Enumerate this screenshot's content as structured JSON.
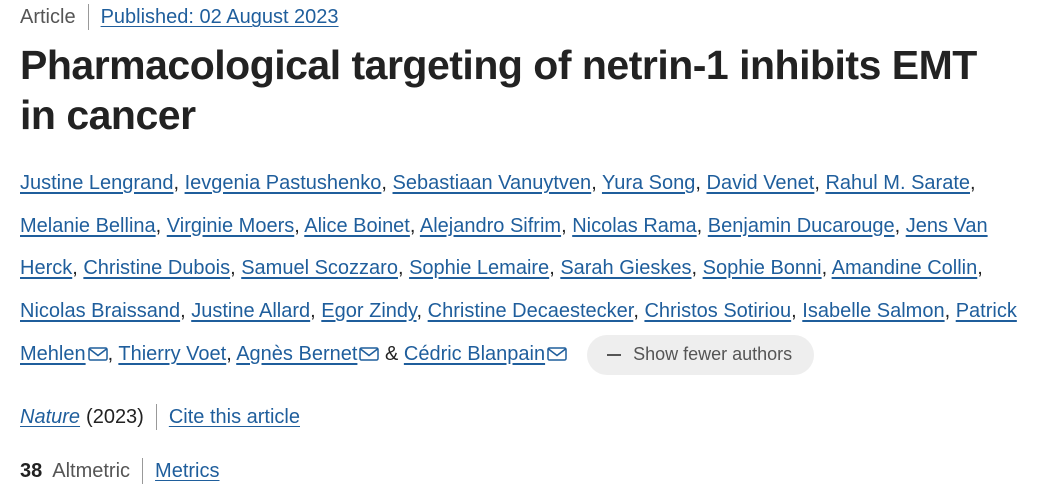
{
  "article": {
    "type_label": "Article",
    "published_label": "Published: 02 August 2023",
    "title": "Pharmacological targeting of netrin-1 inhibits EMT in cancer"
  },
  "authors": [
    {
      "name": "Justine Lengrand",
      "email": false
    },
    {
      "name": "Ievgenia Pastushenko",
      "email": false
    },
    {
      "name": "Sebastiaan Vanuytven",
      "email": false
    },
    {
      "name": "Yura Song",
      "email": false
    },
    {
      "name": "David Venet",
      "email": false
    },
    {
      "name": "Rahul M. Sarate",
      "email": false
    },
    {
      "name": "Melanie Bellina",
      "email": false
    },
    {
      "name": "Virginie Moers",
      "email": false
    },
    {
      "name": "Alice Boinet",
      "email": false
    },
    {
      "name": "Alejandro Sifrim",
      "email": false
    },
    {
      "name": "Nicolas Rama",
      "email": false
    },
    {
      "name": "Benjamin Ducarouge",
      "email": false
    },
    {
      "name": "Jens Van Herck",
      "email": false
    },
    {
      "name": "Christine Dubois",
      "email": false
    },
    {
      "name": "Samuel Scozzaro",
      "email": false
    },
    {
      "name": "Sophie Lemaire",
      "email": false
    },
    {
      "name": "Sarah Gieskes",
      "email": false
    },
    {
      "name": "Sophie Bonni",
      "email": false
    },
    {
      "name": "Amandine Collin",
      "email": false
    },
    {
      "name": "Nicolas Braissand",
      "email": false
    },
    {
      "name": "Justine Allard",
      "email": false
    },
    {
      "name": "Egor Zindy",
      "email": false
    },
    {
      "name": "Christine Decaestecker",
      "email": false
    },
    {
      "name": "Christos Sotiriou",
      "email": false
    },
    {
      "name": "Isabelle Salmon",
      "email": false
    },
    {
      "name": "Patrick Mehlen",
      "email": true
    },
    {
      "name": "Thierry Voet",
      "email": false
    },
    {
      "name": "Agnès Bernet",
      "email": true
    },
    {
      "name": "Cédric Blanpain",
      "email": true
    }
  ],
  "authors_separator": ", ",
  "authors_last_separator": " & ",
  "show_fewer_label": "Show fewer authors",
  "icons": {
    "email": "email-icon",
    "show_fewer": "minus-icon"
  },
  "journal": {
    "name": "Nature",
    "year": "(2023)",
    "cite_label": "Cite this article"
  },
  "metrics": {
    "altmetric_score": "38",
    "altmetric_label": "Altmetric",
    "metrics_link_label": "Metrics"
  },
  "colors": {
    "link": "#1f5e9c",
    "text": "#222222",
    "muted": "#555555",
    "pill_bg": "#eeeeee"
  }
}
